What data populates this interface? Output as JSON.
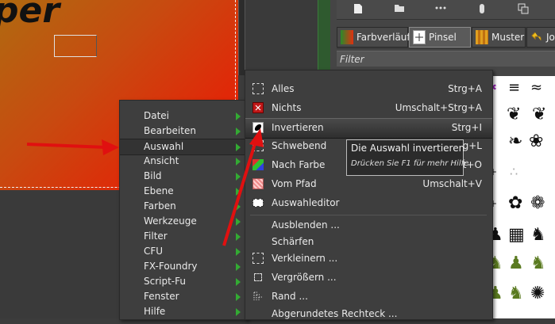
{
  "canvas": {
    "text": "per"
  },
  "dock": {
    "tabs": [
      {
        "label": "Farbverläufe",
        "icon": "gradient-icon"
      },
      {
        "label": "Pinsel",
        "icon": "brush-icon"
      },
      {
        "label": "Muster",
        "icon": "pattern-icon"
      },
      {
        "label": "Journal",
        "icon": "undo-icon"
      }
    ],
    "filter_label": "Filter",
    "toolbar_icons": [
      "new-document-icon",
      "folder-icon",
      "brush-dots-icon",
      "toggle-icon",
      "windows-icon"
    ]
  },
  "main_menu": {
    "items": [
      {
        "label": "Datei"
      },
      {
        "label": "Bearbeiten"
      },
      {
        "label": "Auswahl"
      },
      {
        "label": "Ansicht"
      },
      {
        "label": "Bild"
      },
      {
        "label": "Ebene"
      },
      {
        "label": "Farben"
      },
      {
        "label": "Werkzeuge"
      },
      {
        "label": "Filter"
      },
      {
        "label": "CFU"
      },
      {
        "label": "FX-Foundry"
      },
      {
        "label": "Script-Fu"
      },
      {
        "label": "Fenster"
      },
      {
        "label": "Hilfe"
      }
    ]
  },
  "select_menu": {
    "items": [
      {
        "label": "Alles",
        "shortcut": "Strg+A",
        "icon": "select-all-icon"
      },
      {
        "label": "Nichts",
        "shortcut": "Umschalt+Strg+A",
        "icon": "select-none-icon"
      },
      {
        "label": "Invertieren",
        "shortcut": "Strg+I",
        "icon": "invert-icon"
      },
      {
        "label": "Schwebend",
        "shortcut": "Umschalt+Strg+L",
        "icon": "float-icon"
      },
      {
        "label": "Nach Farbe",
        "shortcut": "Umschalt+O",
        "icon": "by-color-icon"
      },
      {
        "label": "Vom Pfad",
        "shortcut": "Umschalt+V",
        "icon": "from-path-icon"
      },
      {
        "label": "Auswahleditor",
        "shortcut": "",
        "icon": "selection-editor-icon"
      },
      {
        "label": "Ausblenden ...",
        "shortcut": "",
        "icon": ""
      },
      {
        "label": "Schärfen",
        "shortcut": "",
        "icon": ""
      },
      {
        "label": "Verkleinern ...",
        "shortcut": "",
        "icon": "shrink-icon"
      },
      {
        "label": "Vergrößern ...",
        "shortcut": "",
        "icon": "grow-icon"
      },
      {
        "label": "Rand ...",
        "shortcut": "",
        "icon": "border-icon"
      },
      {
        "label": "Abgerundetes Rechteck ...",
        "shortcut": "",
        "icon": ""
      }
    ]
  },
  "tooltip": {
    "title": "Die Auswahl invertieren",
    "hint": "Drücken Sie F1 für mehr Hilfe"
  },
  "colors": {
    "accent_arrow": "#e01010",
    "menu_bg": "#3e3e3e",
    "highlight": "#2e2e2e"
  }
}
